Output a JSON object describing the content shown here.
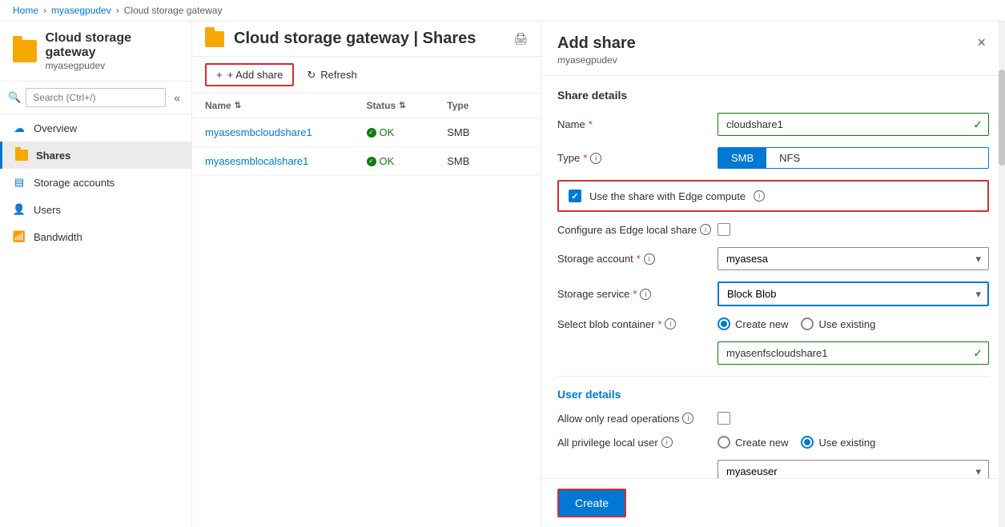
{
  "breadcrumb": {
    "home": "Home",
    "resource_group": "myasegpudev",
    "page": "Cloud storage gateway"
  },
  "resource": {
    "title": "Cloud storage gateway | Shares",
    "subtitle": "myasegpudev",
    "folder_color": "#f7a800"
  },
  "search": {
    "placeholder": "Search (Ctrl+/)"
  },
  "sidebar": {
    "items": [
      {
        "id": "overview",
        "label": "Overview",
        "icon": "cloud",
        "active": false
      },
      {
        "id": "shares",
        "label": "Shares",
        "icon": "folder",
        "active": true
      },
      {
        "id": "storage",
        "label": "Storage accounts",
        "icon": "storage",
        "active": false
      },
      {
        "id": "users",
        "label": "Users",
        "icon": "users",
        "active": false
      },
      {
        "id": "bandwidth",
        "label": "Bandwidth",
        "icon": "bandwidth",
        "active": false
      }
    ]
  },
  "toolbar": {
    "add_share_label": "+ Add share",
    "refresh_label": "Refresh"
  },
  "table": {
    "columns": [
      "Name",
      "Status",
      "Type"
    ],
    "rows": [
      {
        "name": "myasesmbcloudshare1",
        "status": "OK",
        "type": "SMB"
      },
      {
        "name": "myasesmblocalshare1",
        "status": "OK",
        "type": "SMB"
      }
    ]
  },
  "add_share": {
    "title": "Add share",
    "subtitle": "myasegpudev",
    "close_label": "×",
    "share_details_title": "Share details",
    "fields": {
      "name": {
        "label": "Name",
        "required": true,
        "value": "cloudshare1",
        "valid": true
      },
      "type": {
        "label": "Type",
        "required": true,
        "options": [
          "SMB",
          "NFS"
        ],
        "selected": "SMB"
      },
      "edge_compute": {
        "label": "Use the share with Edge compute",
        "checked": true,
        "has_info": true
      },
      "edge_local": {
        "label": "Configure as Edge local share",
        "checked": false,
        "has_info": true
      },
      "storage_account": {
        "label": "Storage account",
        "required": true,
        "has_info": true,
        "value": "myasesa"
      },
      "storage_service": {
        "label": "Storage service",
        "required": true,
        "has_info": true,
        "value": "Block Blob"
      },
      "blob_container": {
        "label": "Select blob container",
        "required": true,
        "has_info": true,
        "options": [
          "Create new",
          "Use existing"
        ],
        "selected": "Create new",
        "value": "myasenfscloudshare1"
      }
    },
    "user_details": {
      "title": "User details",
      "read_only": {
        "label": "Allow only read operations",
        "has_info": true,
        "checked": false
      },
      "privilege": {
        "label": "All privilege local user",
        "has_info": true,
        "options": [
          "Create new",
          "Use existing"
        ],
        "selected": "Use existing",
        "value": "myaseuser"
      }
    },
    "create_label": "Create"
  }
}
